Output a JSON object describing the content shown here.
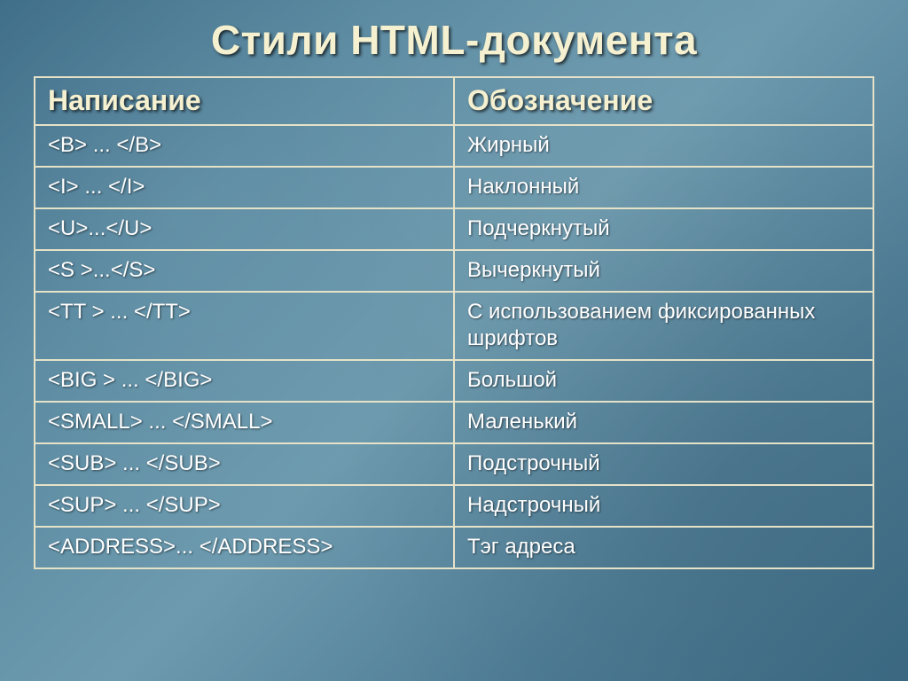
{
  "title": "Стили HTML-документа",
  "headers": {
    "col1": "Написание",
    "col2": "Обозначение"
  },
  "rows": [
    {
      "code": "<B> ... </B>",
      "desc": "Жирный"
    },
    {
      "code": "<I> ... </I>",
      "desc": "Наклонный"
    },
    {
      "code": "<U>...</U>",
      "desc": "Подчеркнутый"
    },
    {
      "code": "<S >...</S>",
      "desc": "Вычеркнутый"
    },
    {
      "code": "<TT > ... </TT>",
      "desc": "С использованием фиксированных шрифтов"
    },
    {
      "code": "<BIG > ... </BIG>",
      "desc": "Большой"
    },
    {
      "code": "<SMALL> ... </SMALL>",
      "desc": "Маленький"
    },
    {
      "code": "<SUB> ... </SUB>",
      "desc": "Подстрочный"
    },
    {
      "code": "<SUP> ... </SUP>",
      "desc": "Надстрочный"
    },
    {
      "code": "<ADDRESS>... </ADDRESS>",
      "desc": "Тэг адреса"
    }
  ]
}
